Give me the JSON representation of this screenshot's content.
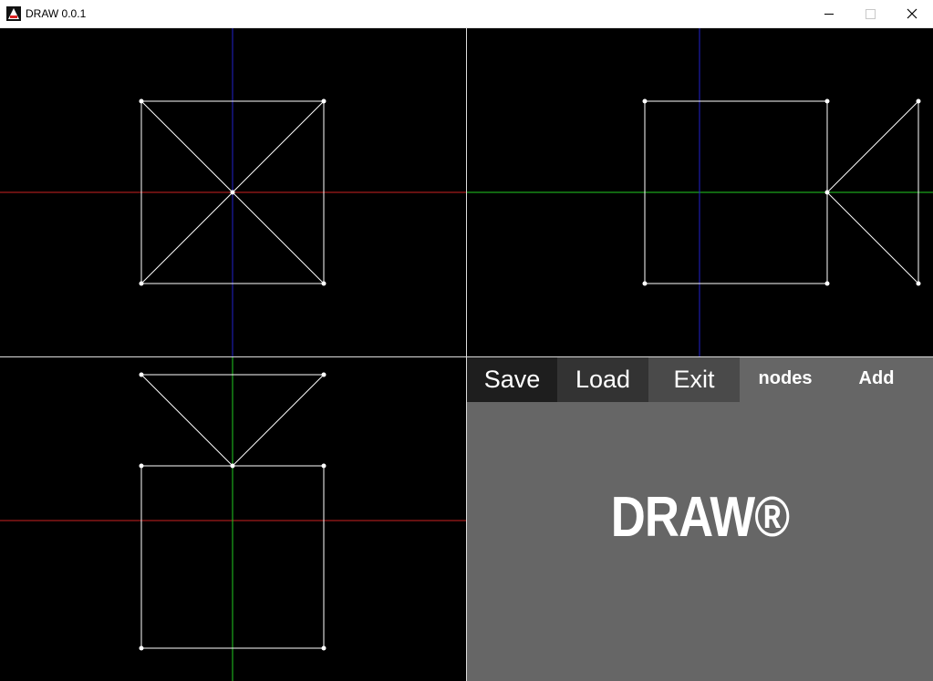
{
  "window": {
    "title": "DRAW 0.0.1",
    "icon": "draw-app-icon",
    "controls": [
      "minimize-icon",
      "maximize-icon",
      "close-icon"
    ]
  },
  "colors": {
    "x_axis": "#cc2222",
    "y_axis": "#2222cc",
    "z_axis": "#22cc22",
    "wire": "#ffffff",
    "panel_bg": "#666666"
  },
  "viewports": {
    "front": {
      "axes": [
        "x_axis",
        "y_axis"
      ],
      "nodes": 5,
      "edges": 8
    },
    "side": {
      "axes": [
        "z_axis",
        "y_axis"
      ],
      "nodes": 7,
      "edges": 7
    },
    "top": {
      "axes": [
        "x_axis",
        "z_axis"
      ],
      "nodes": 7,
      "edges": 7
    }
  },
  "toolbar": {
    "save_label": "Save",
    "load_label": "Load",
    "exit_label": "Exit",
    "nodes_label": "nodes",
    "add_label": "Add"
  },
  "logo": {
    "text": "DRAW®"
  }
}
